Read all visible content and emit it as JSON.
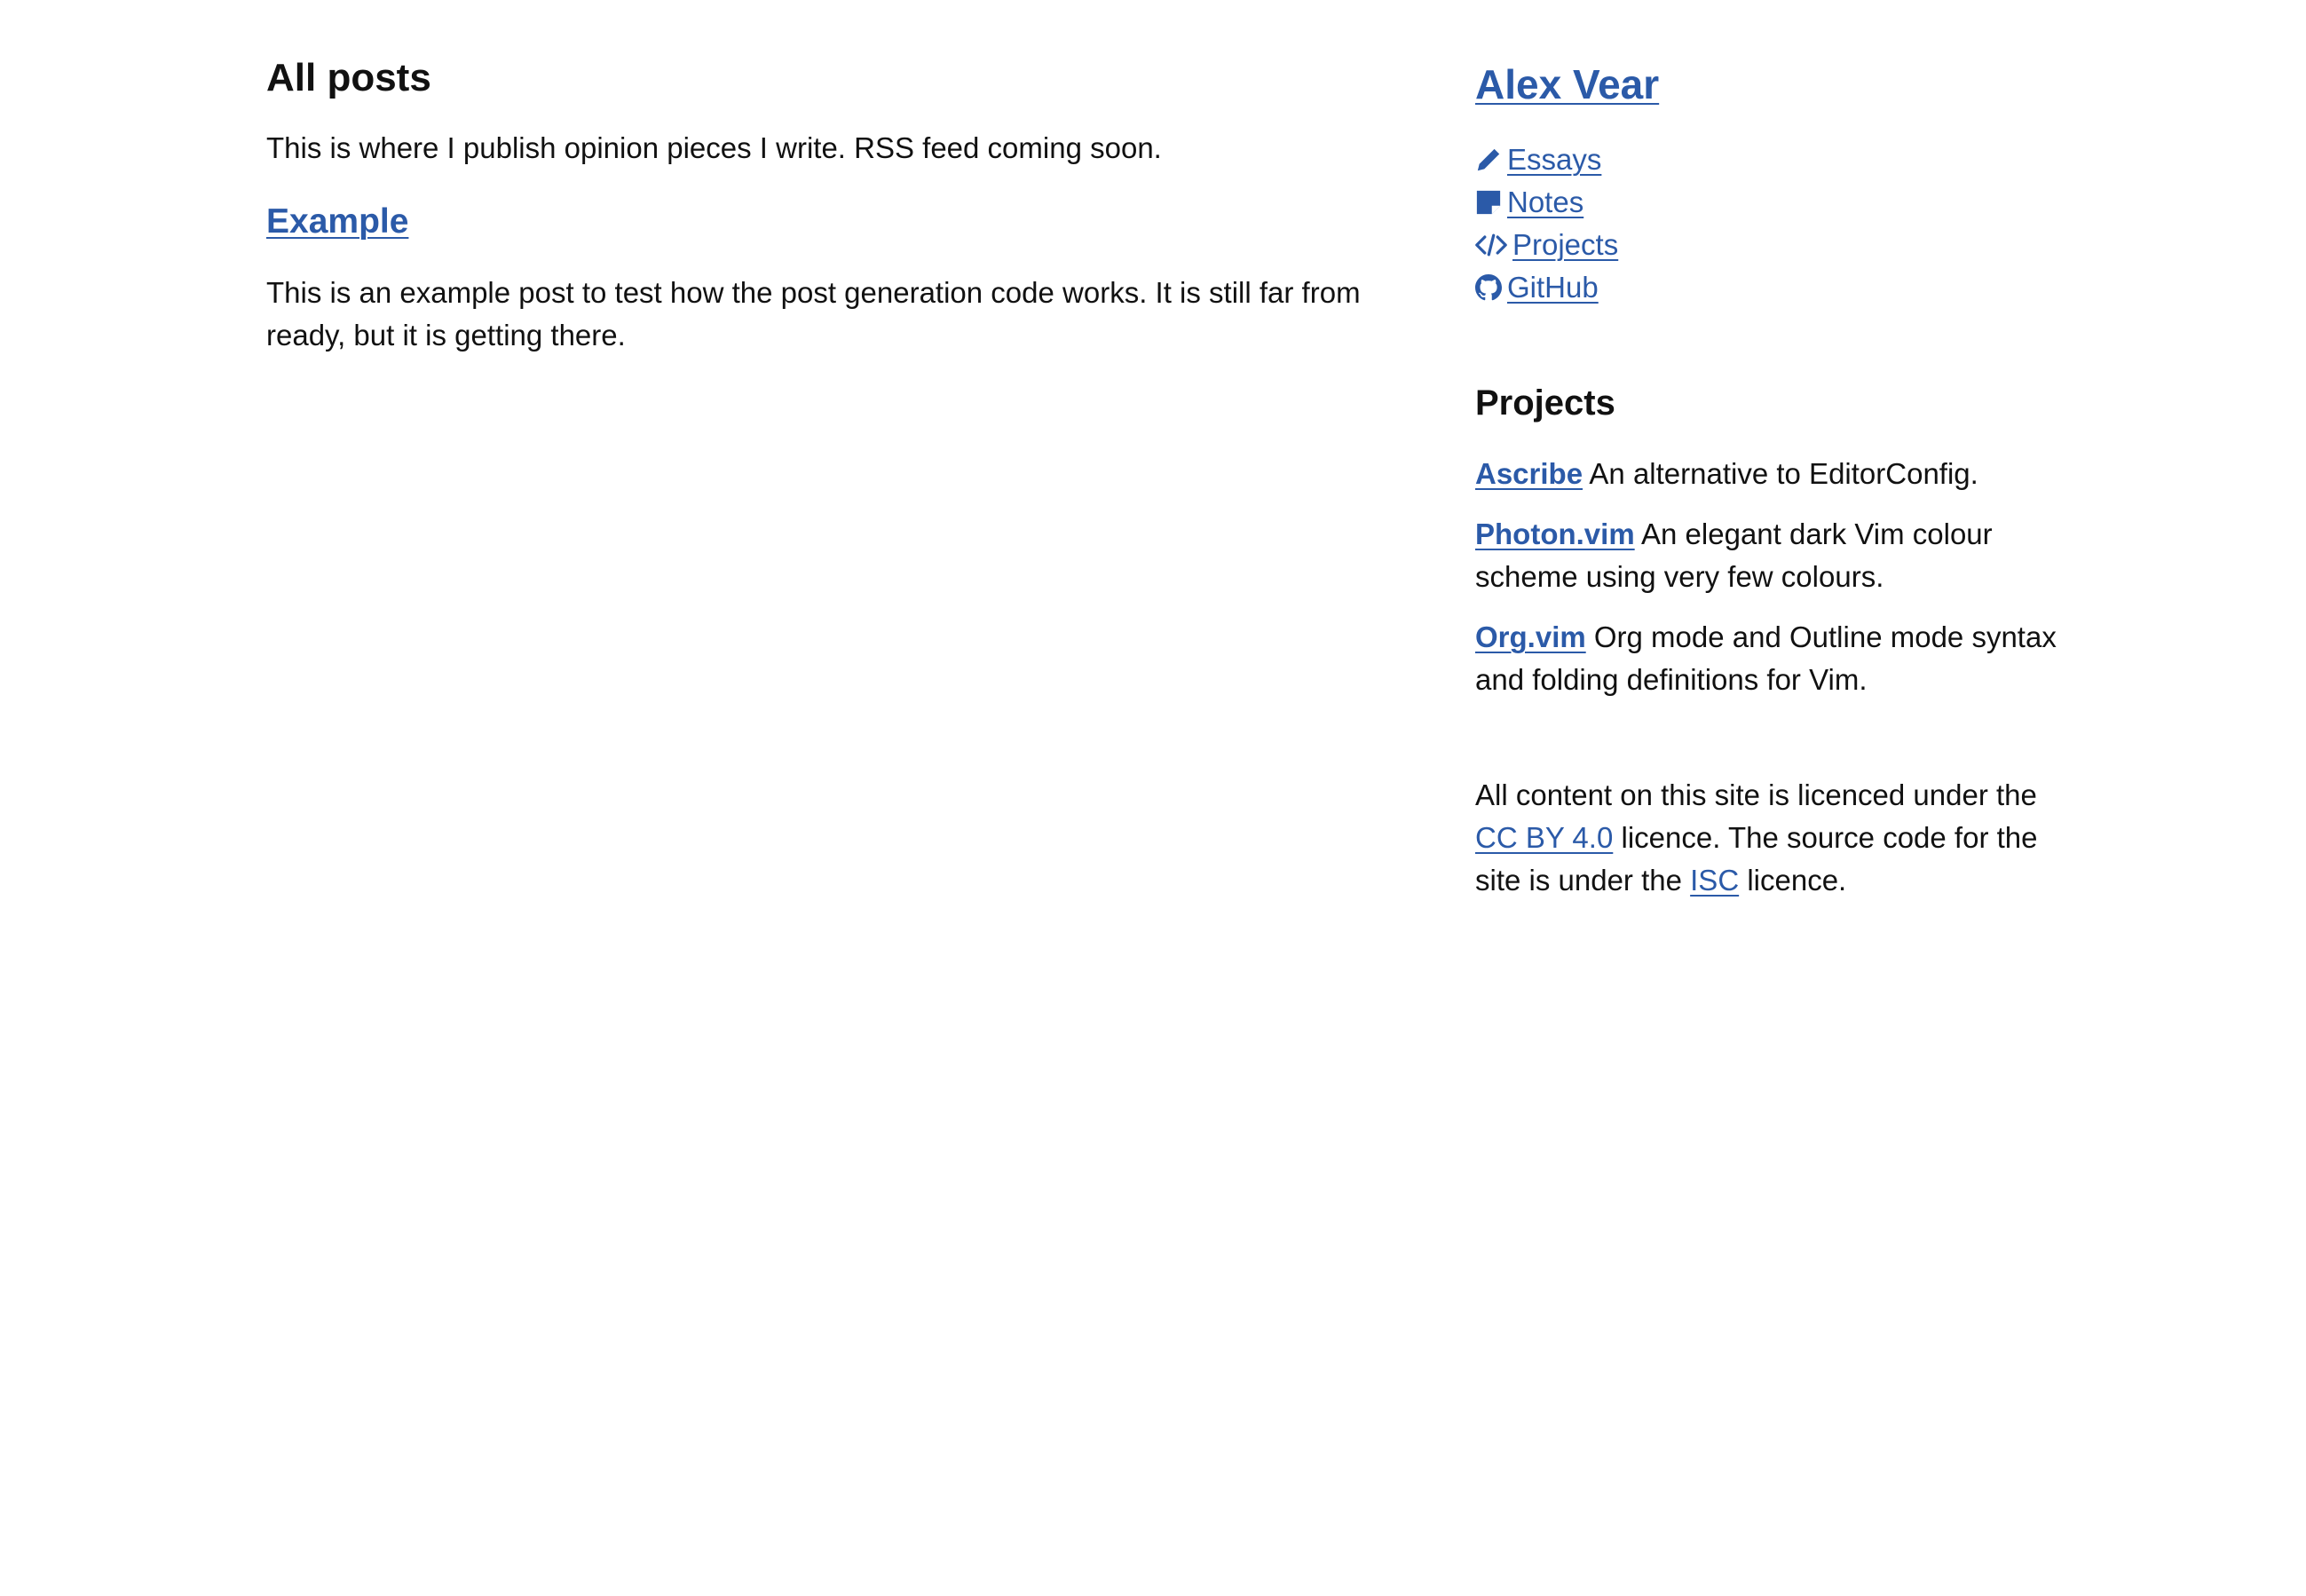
{
  "main": {
    "title": "All posts",
    "intro": "This is where I publish opinion pieces I write. RSS feed coming soon.",
    "posts": [
      {
        "title": "Example",
        "summary": "This is an example post to test how the post generation code works. It is still far from ready, but it is getting there."
      }
    ]
  },
  "sidebar": {
    "site_name": "Alex Vear",
    "nav": [
      {
        "label": "Essays",
        "icon": "pencil-icon"
      },
      {
        "label": "Notes",
        "icon": "sticky-note-icon"
      },
      {
        "label": "Projects",
        "icon": "code-icon"
      },
      {
        "label": "GitHub",
        "icon": "github-icon"
      }
    ],
    "projects_title": "Projects",
    "projects": [
      {
        "name": "Ascribe",
        "description": " An alternative to EditorConfig."
      },
      {
        "name": "Photon.vim",
        "description": " An elegant dark Vim colour scheme using very few colours."
      },
      {
        "name": "Org.vim",
        "description": " Org mode and Outline mode syntax and folding definitions for Vim."
      }
    ],
    "licence": {
      "text_before": "All content on this site is licenced under the ",
      "content_licence_link": "CC BY 4.0",
      "text_middle": " licence. The source code for the site is under the ",
      "code_licence_link": "ISC",
      "text_after": " licence."
    }
  },
  "colors": {
    "link": "#2b5aa8",
    "text": "#111111",
    "background": "#ffffff"
  }
}
